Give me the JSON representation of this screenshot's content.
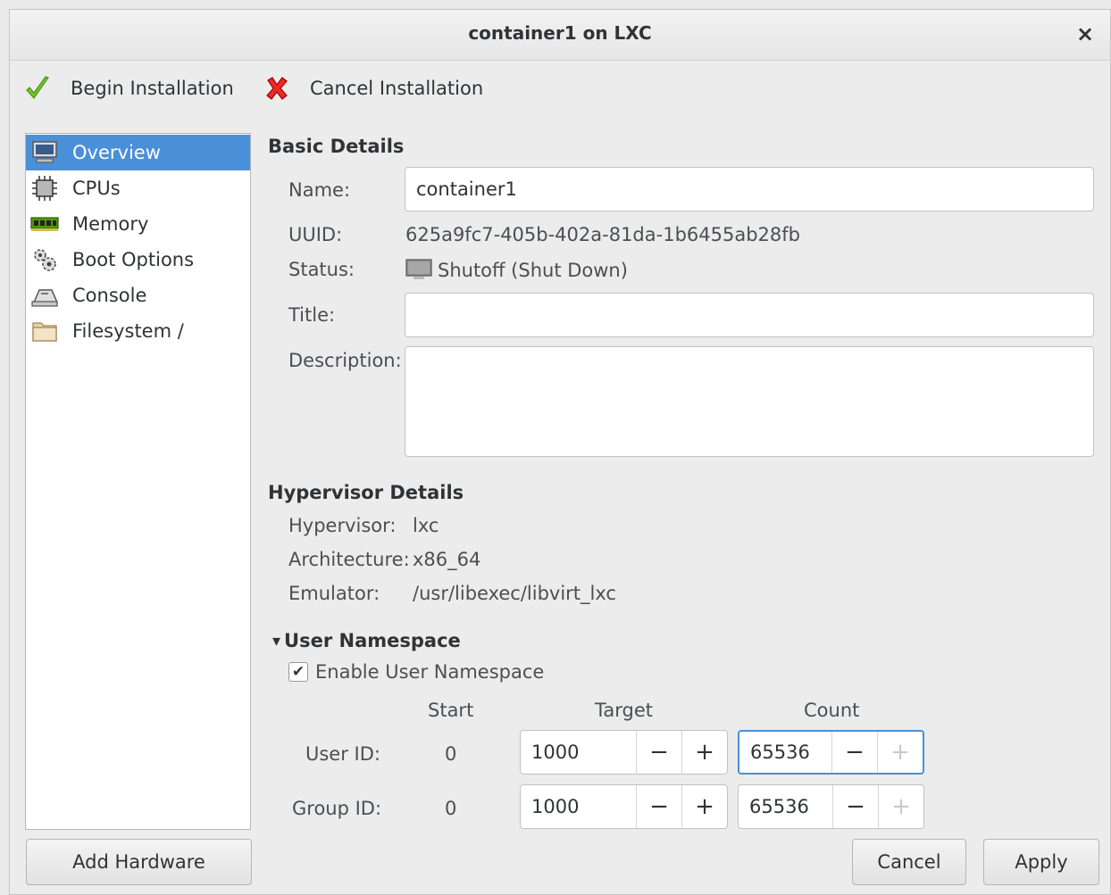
{
  "window": {
    "title": "container1 on LXC",
    "close_glyph": "×"
  },
  "toolbar": {
    "begin_label": "Begin Installation",
    "cancel_label": "Cancel Installation"
  },
  "sidebar": {
    "items": [
      {
        "label": "Overview",
        "icon": "monitor-icon"
      },
      {
        "label": "CPUs",
        "icon": "cpu-icon"
      },
      {
        "label": "Memory",
        "icon": "memory-icon"
      },
      {
        "label": "Boot Options",
        "icon": "gears-icon"
      },
      {
        "label": "Console",
        "icon": "console-icon"
      },
      {
        "label": "Filesystem /",
        "icon": "folder-icon"
      }
    ],
    "selected_index": 0,
    "add_hardware_label": "Add Hardware"
  },
  "basic": {
    "header": "Basic Details",
    "name_label": "Name:",
    "name_value": "container1",
    "uuid_label": "UUID:",
    "uuid_value": "625a9fc7-405b-402a-81da-1b6455ab28fb",
    "status_label": "Status:",
    "status_value": "Shutoff (Shut Down)",
    "title_label": "Title:",
    "title_value": "",
    "description_label": "Description:",
    "description_value": ""
  },
  "hypervisor": {
    "header": "Hypervisor Details",
    "hypervisor_label": "Hypervisor:",
    "hypervisor_value": "lxc",
    "arch_label": "Architecture:",
    "arch_value": "x86_64",
    "emulator_label": "Emulator:",
    "emulator_value": "/usr/libexec/libvirt_lxc"
  },
  "userns": {
    "expander_glyph": "▾",
    "header": "User Namespace",
    "enable_label": "Enable User Namespace",
    "enabled": true,
    "col_start": "Start",
    "col_target": "Target",
    "col_count": "Count",
    "user_label": "User ID:",
    "user_start": "0",
    "user_target": "1000",
    "user_count": "65536",
    "group_label": "Group ID:",
    "group_start": "0",
    "group_target": "1000",
    "group_count": "65536",
    "minus": "−",
    "plus": "+"
  },
  "footer": {
    "cancel_label": "Cancel",
    "apply_label": "Apply"
  },
  "colors": {
    "accent": "#4a90d9",
    "window_bg": "#ececec",
    "sidebar_bg": "#ffffff"
  }
}
